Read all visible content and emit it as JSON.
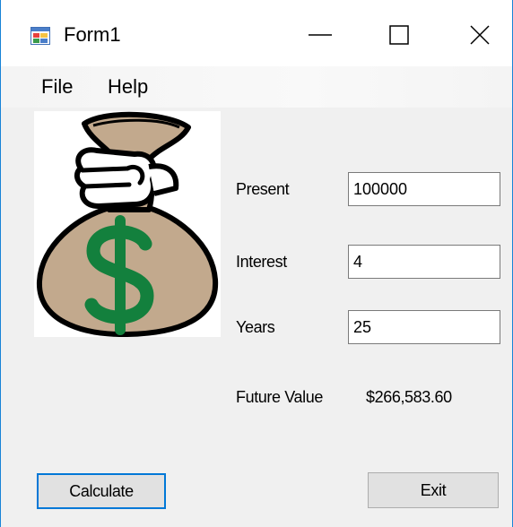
{
  "window": {
    "title": "Form1"
  },
  "menu": {
    "items": [
      "File",
      "Help"
    ]
  },
  "form": {
    "present_label": "Present",
    "present_value": "100000",
    "interest_label": "Interest",
    "interest_value": "4",
    "years_label": "Years",
    "years_value": "25",
    "future_value_label": "Future Value",
    "future_value_result": "$266,583.60"
  },
  "buttons": {
    "calculate_label": "Calculate",
    "exit_label": "Exit"
  },
  "colors": {
    "accent": "#0078d7",
    "window_border": "#1883d7",
    "bag": "#c2a98d",
    "dollar": "#13803d"
  },
  "icons": {
    "app": "windows-form-icon",
    "picture": "money-bag-icon"
  }
}
